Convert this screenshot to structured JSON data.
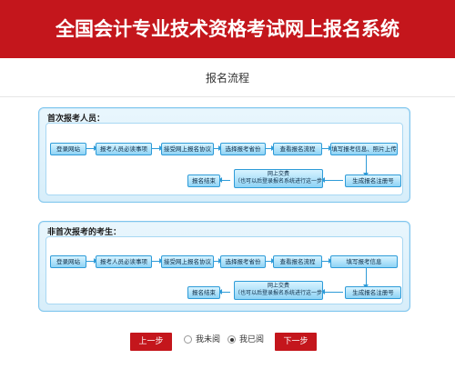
{
  "header": {
    "title": "全国会计专业技术资格考试网上报名系统"
  },
  "page": {
    "subtitle": "报名流程"
  },
  "panel1": {
    "title": "首次报考人员：",
    "row1": [
      "登录网站",
      "报考人员必读事项",
      "接受网上报名协议",
      "选择报考省份",
      "查看报名流程",
      "填写报考信息、照片上传"
    ],
    "row2_end": "生成报名注册号",
    "pay_line1": "网上交费",
    "pay_line2": "（也可以后登录报名系统进行这一步）",
    "finish": "报名结束"
  },
  "panel2": {
    "title": "非首次报考的考生：",
    "row1": [
      "登录网站",
      "报考人员必读事项",
      "接受网上报名协议",
      "选择报考省份",
      "查看报名流程",
      "填写报考信息"
    ],
    "row2_end": "生成报名注册号",
    "pay_line1": "网上交费",
    "pay_line2": "（也可以后登录报名系统进行这一步）",
    "finish": "报名结束"
  },
  "footer": {
    "prev": "上一步",
    "next": "下一步",
    "radio_unread": "我未阅",
    "radio_read": "我已阅"
  },
  "colors": {
    "brand_red": "#c4161c",
    "step_border": "#2e9bd8"
  }
}
